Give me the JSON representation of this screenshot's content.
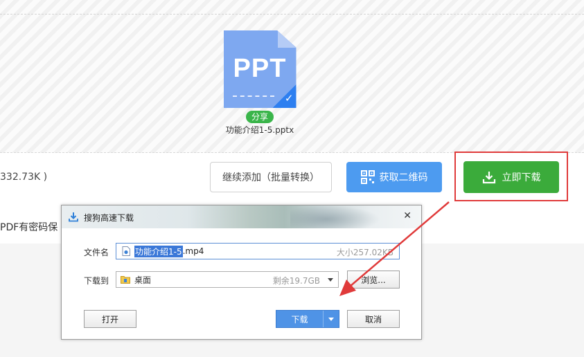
{
  "file_card": {
    "icon_text": "PPT",
    "share_badge": "分享",
    "file_name": "功能介绍1-5.pptx"
  },
  "action_bar": {
    "size_text": "332.73K )",
    "continue_button": "继续添加（批量转换）",
    "qr_button": "获取二维码",
    "download_button": "立即下载"
  },
  "notice": {
    "text": "PDF有密码保"
  },
  "dialog": {
    "title": "搜狗高速下载",
    "file_name_label": "文件名",
    "file_name_selected": "功能介绍1-5",
    "file_name_ext": ".mp4",
    "file_size_hint": "大小257.02KB",
    "save_to_label": "下载到",
    "save_to_value": "桌面",
    "free_space_hint": "剩余19.7GB",
    "browse_button": "浏览...",
    "open_button": "打开",
    "download_button": "下载",
    "cancel_button": "取消"
  },
  "colors": {
    "download_green": "#3bab3b",
    "qr_blue": "#4d9bf0",
    "highlight_red": "#e03a3a",
    "share_green": "#3ab54a"
  },
  "icons": [
    "ppt-file-icon",
    "check-icon",
    "qr-code-icon",
    "download-icon",
    "title-download-icon",
    "close-icon",
    "file-icon",
    "folder-icon",
    "dropdown-arrow-icon"
  ]
}
